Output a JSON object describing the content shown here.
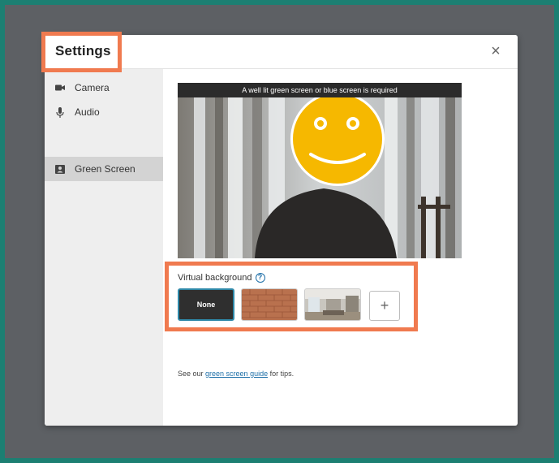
{
  "window": {
    "title": "Settings",
    "close_glyph": "×"
  },
  "sidebar": {
    "items": [
      {
        "label": "Camera",
        "icon": "camera-icon",
        "active": false
      },
      {
        "label": "Audio",
        "icon": "microphone-icon",
        "active": false
      },
      {
        "label": "Green Screen",
        "icon": "contact-card-icon",
        "active": true
      }
    ]
  },
  "preview": {
    "banner": "A well lit green screen or blue screen is required"
  },
  "virtual_background": {
    "label": "Virtual background",
    "help_glyph": "?",
    "options": [
      {
        "label": "None",
        "selected": true
      },
      {
        "label": "",
        "kind": "brick-wall-image",
        "selected": false
      },
      {
        "label": "",
        "kind": "room-interior-image",
        "selected": false
      }
    ],
    "add_glyph": "+"
  },
  "tips": {
    "prefix": "See our ",
    "link": "green screen guide",
    "suffix": " for tips."
  },
  "colors": {
    "accent_highlight": "#f07a4f",
    "link": "#1e6fa8",
    "selected_border": "#2e88a8"
  }
}
